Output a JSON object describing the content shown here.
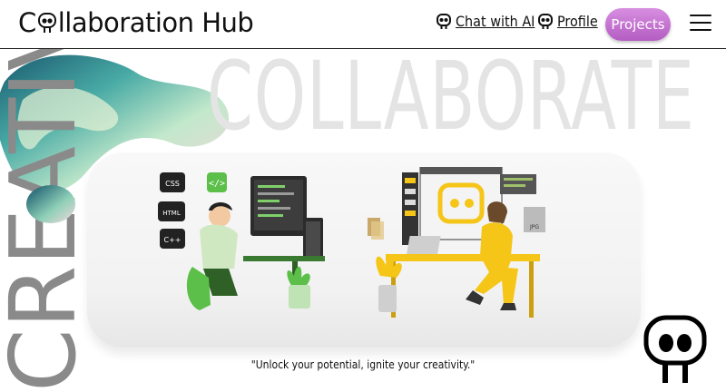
{
  "header": {
    "brand_prefix": "C",
    "brand_suffix": "llaboration Hub",
    "nav": {
      "chat_label": "Chat with AI",
      "profile_label": "Profile",
      "projects_label": "Projects"
    }
  },
  "hero": {
    "background_word": "COLLABORATE",
    "vertical_word": "CREATIVE",
    "tagline": "\"Unlock your potential, ignite your creativity.\"",
    "code_badges": [
      "CSS",
      "HTML",
      "C++"
    ],
    "jpg_label": "JPG"
  },
  "colors": {
    "accent": "#c06fd0",
    "yellow": "#f5c518",
    "green": "#4aa03c"
  }
}
